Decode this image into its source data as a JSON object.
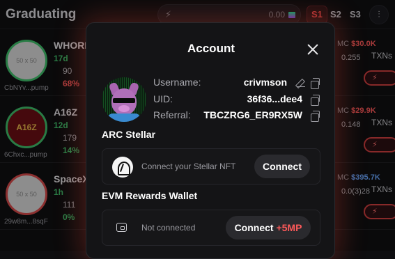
{
  "background": {
    "title": "Graduating",
    "search_amount": "0.00",
    "presets": [
      "S1",
      "S2",
      "S3"
    ],
    "rows": [
      {
        "name": "WHORI",
        "age": "17d",
        "holders": "90",
        "pct": "68%",
        "pct_dir": "down",
        "addr": "CbNYv...pump",
        "mc_label": "MC",
        "mc_value": "$30.0K",
        "price": "0.255",
        "txns": "TXNs",
        "avatar": "50 x 50"
      },
      {
        "name": "A16Z",
        "age": "12d",
        "holders": "179",
        "pct": "14%",
        "pct_dir": "up",
        "addr": "6Chxc...pump",
        "mc_label": "MC",
        "mc_value": "$29.9K",
        "price": "0.148",
        "txns": "TXNs",
        "avatar": "A16Z"
      },
      {
        "name": "SpaceX",
        "age": "1h",
        "holders": "111",
        "pct": "0%",
        "pct_dir": "up",
        "addr": "29w8m...8sqF",
        "mc_label": "MC",
        "mc_value": "$395.7K",
        "price": "0.0(3)28",
        "txns": "TXNs",
        "avatar": "50 x 50"
      }
    ]
  },
  "modal": {
    "title": "Account",
    "username_label": "Username:",
    "username_value": "crivmson",
    "uid_label": "UID:",
    "uid_value": "36f36...dee4",
    "referral_label": "Referral:",
    "referral_value": "TBCZRG6_ER9RX5W",
    "arc_title": "ARC Stellar",
    "arc_text": "Connect your Stellar NFT",
    "arc_button": "Connect",
    "evm_title": "EVM Rewards Wallet",
    "evm_text": "Not connected",
    "evm_button": "Connect",
    "evm_bonus": "+5MP"
  },
  "colors": {
    "accent_red": "#ff5a5a",
    "positive_green": "#3fbf6a",
    "modal_bg": "#141416",
    "glow": "#ff503c"
  }
}
